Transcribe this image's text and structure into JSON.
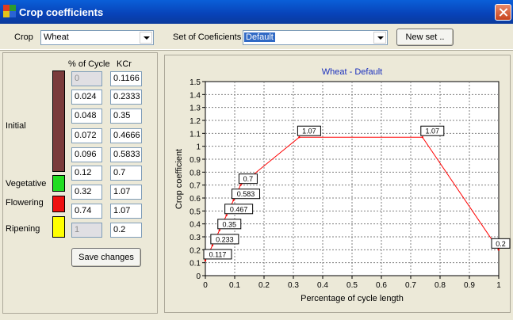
{
  "window": {
    "title": "Crop coefficients"
  },
  "toolbar": {
    "crop_label": "Crop",
    "crop_value": "Wheat",
    "set_label": "Set of Coeficients",
    "set_value": "Default",
    "new_set_label": "New set .."
  },
  "table": {
    "col_cycle": "% of Cycle",
    "col_kcr": "KCr",
    "rows": [
      {
        "cycle": "0",
        "kcr": "0.1166",
        "cycle_disabled": true
      },
      {
        "cycle": "0.024",
        "kcr": "0.2333"
      },
      {
        "cycle": "0.048",
        "kcr": "0.35"
      },
      {
        "cycle": "0.072",
        "kcr": "0.4666"
      },
      {
        "cycle": "0.096",
        "kcr": "0.5833"
      },
      {
        "cycle": "0.12",
        "kcr": "0.7"
      },
      {
        "cycle": "0.32",
        "kcr": "1.07"
      },
      {
        "cycle": "0.74",
        "kcr": "1.07"
      },
      {
        "cycle": "1",
        "kcr": "0.2",
        "cycle_disabled": true
      }
    ]
  },
  "stages": [
    {
      "label": "Initial",
      "color": "#7a3b3b"
    },
    {
      "label": "Vegetative",
      "color": "#22dd22"
    },
    {
      "label": "Flowering",
      "color": "#ee1111"
    },
    {
      "label": "Ripening",
      "color": "#ffff00"
    }
  ],
  "save_label": "Save changes",
  "chart_data": {
    "type": "line",
    "title": "Wheat - Default",
    "xlabel": "Percentage of cycle length",
    "ylabel": "Crop coefficient",
    "xlim": [
      0,
      1
    ],
    "ylim": [
      0,
      1.5
    ],
    "xticks": [
      "0",
      "0.1",
      "0.2",
      "0.3",
      "0.4",
      "0.5",
      "0.6",
      "0.7",
      "0.8",
      "0.9",
      "1"
    ],
    "yticks": [
      "0",
      "0.1",
      "0.2",
      "0.3",
      "0.4",
      "0.5",
      "0.6",
      "0.7",
      "0.8",
      "0.9",
      "1",
      "1.1",
      "1.2",
      "1.3",
      "1.4",
      "1.5"
    ],
    "grid": true,
    "line_color": "#ff0000",
    "points": [
      {
        "x": 0,
        "y": 0.1166,
        "label": "0.117"
      },
      {
        "x": 0.024,
        "y": 0.2333,
        "label": "0.233"
      },
      {
        "x": 0.048,
        "y": 0.35,
        "label": "0.35"
      },
      {
        "x": 0.072,
        "y": 0.4666,
        "label": "0.467"
      },
      {
        "x": 0.096,
        "y": 0.5833,
        "label": "0.583"
      },
      {
        "x": 0.12,
        "y": 0.7,
        "label": "0.7"
      },
      {
        "x": 0.32,
        "y": 1.07,
        "label": "1.07"
      },
      {
        "x": 0.74,
        "y": 1.07,
        "label": "1.07"
      },
      {
        "x": 1,
        "y": 0.2,
        "label": "0.2"
      }
    ]
  }
}
